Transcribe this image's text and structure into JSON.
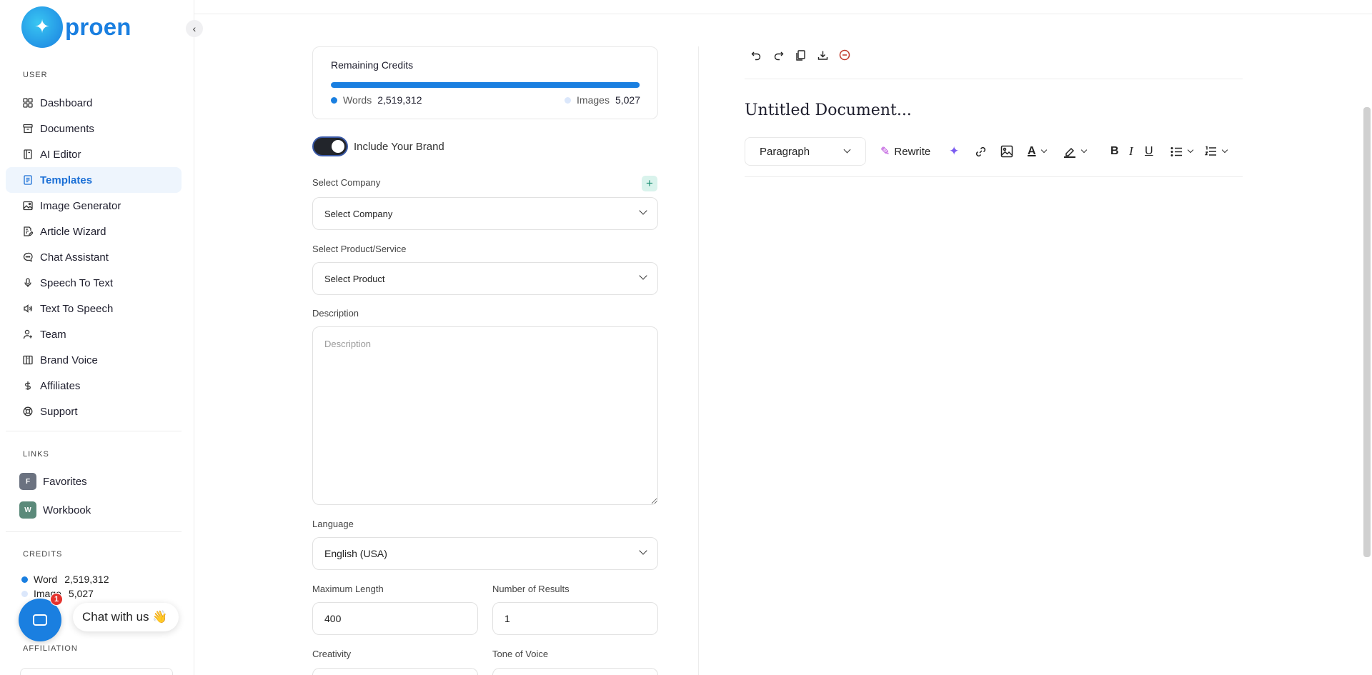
{
  "brand": {
    "name": "proen"
  },
  "sidebar": {
    "user_label": "USER",
    "items": [
      {
        "label": "Dashboard",
        "icon": "grid-icon"
      },
      {
        "label": "Documents",
        "icon": "archive-icon"
      },
      {
        "label": "AI Editor",
        "icon": "notebook-icon"
      },
      {
        "label": "Templates",
        "icon": "document-icon"
      },
      {
        "label": "Image Generator",
        "icon": "image-icon"
      },
      {
        "label": "Article Wizard",
        "icon": "article-icon"
      },
      {
        "label": "Chat Assistant",
        "icon": "chat-icon"
      },
      {
        "label": "Speech To Text",
        "icon": "microphone-icon"
      },
      {
        "label": "Text To Speech",
        "icon": "speaker-icon"
      },
      {
        "label": "Team",
        "icon": "user-plus-icon"
      },
      {
        "label": "Brand Voice",
        "icon": "columns-icon"
      },
      {
        "label": "Affiliates",
        "icon": "dollar-icon"
      },
      {
        "label": "Support",
        "icon": "lifebuoy-icon"
      }
    ],
    "active_item": "Templates",
    "links_label": "LINKS",
    "links": [
      {
        "badge": "F",
        "label": "Favorites",
        "color": "#6b7280"
      },
      {
        "badge": "W",
        "label": "Workbook",
        "color": "#5b8a7a"
      }
    ],
    "credits_label": "CREDITS",
    "credits": {
      "word_label": "Word",
      "word_value": "2,519,312",
      "image_label": "Image",
      "image_value": "5,027"
    },
    "affiliation_label": "AFFILIATION"
  },
  "chat": {
    "badge_count": "1",
    "label": "Chat with us 👋"
  },
  "form": {
    "remaining_credits_title": "Remaining Credits",
    "words_label": "Words",
    "words_value": "2,519,312",
    "images_label": "Images",
    "images_value": "5,027",
    "words_fill_fraction": 0.998,
    "include_brand_label": "Include Your Brand",
    "include_brand_on": true,
    "select_company_label": "Select Company",
    "select_company_value": "Select Company",
    "select_product_label": "Select Product/Service",
    "select_product_value": "Select Product",
    "description_label": "Description",
    "description_placeholder": "Description",
    "language_label": "Language",
    "language_value": "English (USA)",
    "max_length_label": "Maximum Length",
    "max_length_value": "400",
    "num_results_label": "Number of Results",
    "num_results_value": "1",
    "creativity_label": "Creativity",
    "tone_label": "Tone of Voice"
  },
  "editor": {
    "document_title": "Untitled Document...",
    "paragraph_value": "Paragraph",
    "rewrite_label": "Rewrite",
    "bold_label": "B",
    "italic_label": "I",
    "underline_label": "U",
    "text_color_label": "A"
  },
  "colors": {
    "accent": "#1a7fe0",
    "active_bg": "#eef5fd",
    "image_dot": "#dbe7fb",
    "danger": "#c0392b"
  }
}
